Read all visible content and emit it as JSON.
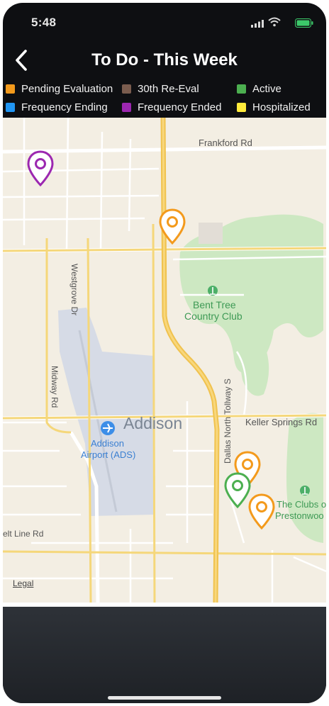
{
  "status_bar": {
    "time": "5:48"
  },
  "header": {
    "title": "To Do - This Week"
  },
  "legend": {
    "items": [
      {
        "label": "Pending Evaluation",
        "color": "#f39a1c"
      },
      {
        "label": "30th Re-Eval",
        "color": "#7a5c4e"
      },
      {
        "label": "Active",
        "color": "#4caf50"
      },
      {
        "label": "Frequency Ending",
        "color": "#2196f3"
      },
      {
        "label": "Frequency Ended",
        "color": "#9c27b0"
      },
      {
        "label": "Hospitalized",
        "color": "#ffeb3b"
      }
    ]
  },
  "map": {
    "labels": {
      "frankford": "Frankford Rd",
      "westgrove": "Westgrove Dr",
      "midway": "Midway Rd",
      "bent_tree_1": "Bent Tree",
      "bent_tree_2": "Country Club",
      "addison": "Addison",
      "addison_airport_1": "Addison",
      "addison_airport_2": "Airport (ADS)",
      "keller": "Keller Springs Rd",
      "tollway": "Dallas North Tollway S",
      "clubs_1": "The Clubs o",
      "clubs_2": "Prestonwoo",
      "belt_line": "elt Line Rd",
      "legal": "Legal"
    },
    "pins": [
      {
        "status": "Frequency Ended",
        "color": "#9c27b0"
      },
      {
        "status": "Pending Evaluation",
        "color": "#f39a1c"
      },
      {
        "status": "Pending Evaluation",
        "color": "#f39a1c"
      },
      {
        "status": "Active",
        "color": "#4caf50"
      },
      {
        "status": "Pending Evaluation",
        "color": "#f39a1c"
      }
    ]
  }
}
